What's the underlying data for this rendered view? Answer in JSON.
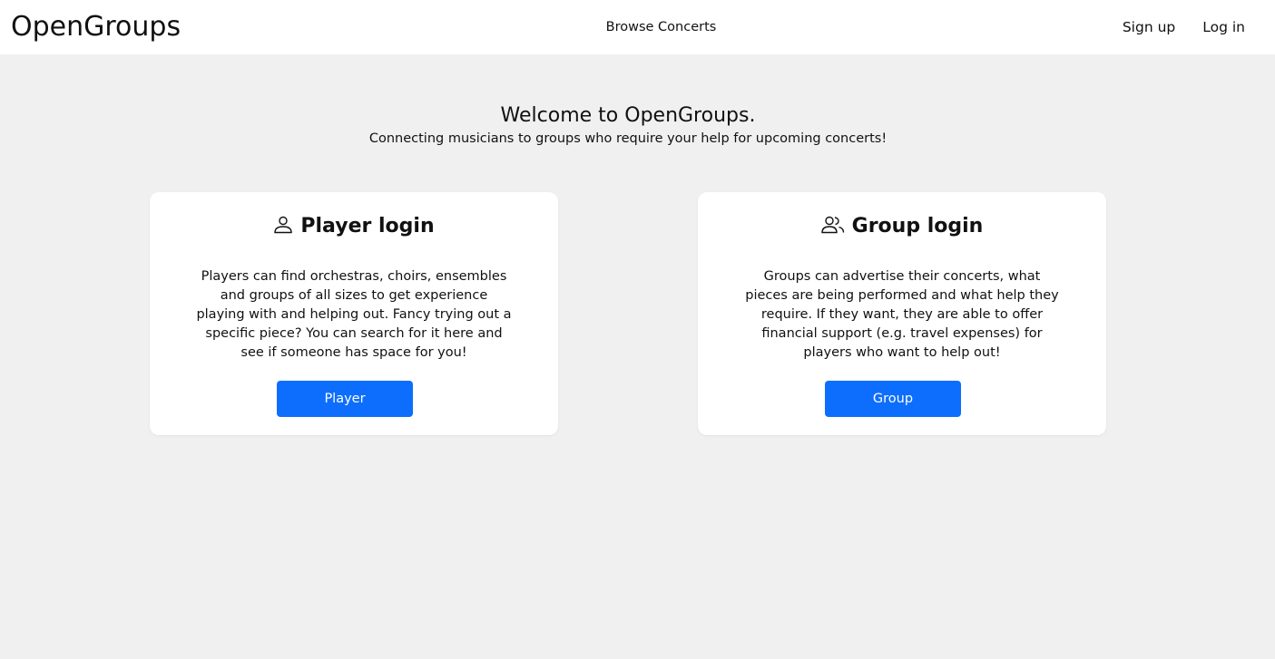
{
  "nav": {
    "brand": "OpenGroups",
    "browse": "Browse Concerts",
    "signup": "Sign up",
    "login": "Log in"
  },
  "hero": {
    "title": "Welcome to OpenGroups.",
    "subtitle": "Connecting musicians to groups who require your help for upcoming concerts!"
  },
  "cards": {
    "player": {
      "icon": "person-icon",
      "title": "Player login",
      "text": "Players can find orchestras, choirs, ensembles and groups of all sizes to get experience playing with and helping out. Fancy trying out a specific piece? You can search for it here and see if someone has space for you!",
      "button": "Player"
    },
    "group": {
      "icon": "people-icon",
      "title": "Group login",
      "text": "Groups can advertise their concerts, what pieces are being performed and what help they require. If they want, they are able to offer financial support (e.g. travel expenses) for players who want to help out!",
      "button": "Group"
    }
  },
  "colors": {
    "background": "#f0f0f0",
    "card": "#ffffff",
    "button": "#0d6efd"
  }
}
